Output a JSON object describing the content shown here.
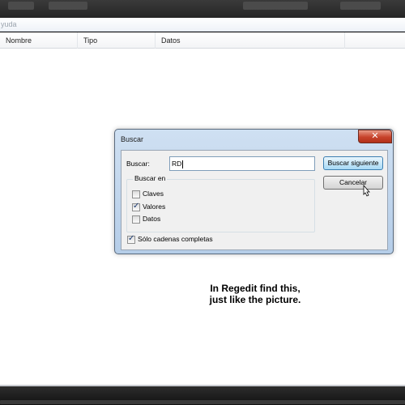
{
  "menubar": {
    "partial_item": "yuda"
  },
  "listview": {
    "columns": [
      "Nombre",
      "Tipo",
      "Datos"
    ]
  },
  "dialog": {
    "title": "Buscar",
    "close_glyph": "✕",
    "find_label": "Buscar:",
    "find_value": "RD",
    "find_next_label": "Buscar siguiente",
    "cancel_label": "Cancelar",
    "group_title": "Buscar en",
    "options": [
      {
        "label": "Claves",
        "checked": false
      },
      {
        "label": "Valores",
        "checked": true
      },
      {
        "label": "Datos",
        "checked": false
      }
    ],
    "whole_string": {
      "label": "Sólo cadenas completas",
      "checked": true
    }
  },
  "annotation": {
    "line1": "In Regedit find this,",
    "line2": "just like the picture."
  },
  "icons": {
    "close": "close-icon",
    "cursor": "mouse-pointer-icon",
    "check": "checkmark-icon"
  },
  "colors": {
    "dialog_frame": "#b5cde8",
    "close_button": "#c7432c",
    "primary_button": "#a7d9f5"
  }
}
